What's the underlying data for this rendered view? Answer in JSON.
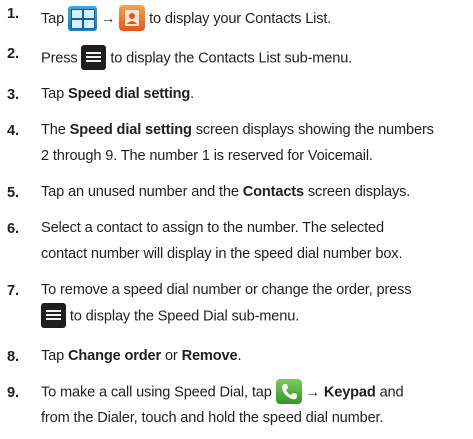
{
  "steps": [
    {
      "num": "1.",
      "pre": "Tap ",
      "mid": " ",
      "arrow": "→",
      "post": " to display your Contacts List."
    },
    {
      "num": "2.",
      "pre": "Press ",
      "post": " to display the Contacts List sub-menu."
    },
    {
      "num": "3.",
      "pre": "Tap ",
      "bold": "Speed dial setting",
      "post": "."
    },
    {
      "num": "4.",
      "l1_pre": "The ",
      "l1_bold": "Speed dial setting",
      "l1_post": " screen displays showing the numbers",
      "l2": "2 through 9. The number 1 is reserved for Voicemail."
    },
    {
      "num": "5.",
      "pre": "Tap an unused number and the ",
      "bold": "Contacts",
      "post": " screen displays."
    },
    {
      "num": "6.",
      "l1": "Select a contact to assign to the number. The selected",
      "l2": "contact number will display in the speed dial number box."
    },
    {
      "num": "7.",
      "l1": "To remove a speed dial number or change the order, press",
      "l2_post": " to display the Speed Dial sub-menu."
    },
    {
      "num": "8.",
      "pre": "Tap ",
      "bold1": "Change order",
      "mid": " or ",
      "bold2": "Remove",
      "post": "."
    },
    {
      "num": "9.",
      "l1_pre": "To make a call using Speed Dial, tap ",
      "arrow": "→",
      "l1_bold": "Keypad",
      "l1_post": " and",
      "l2": "from the Dialer, touch and hold the speed dial number."
    }
  ],
  "icons": {
    "apps": "applications-grid-icon",
    "contacts": "contacts-icon",
    "menu": "menu-key-icon",
    "phone": "phone-icon"
  },
  "colors": {
    "text": "#231f20",
    "apps_blue": "#1a7cc4",
    "contacts_orange": "#e1541c",
    "phone_green": "#33962a",
    "menu_black": "#1e1e1e"
  }
}
